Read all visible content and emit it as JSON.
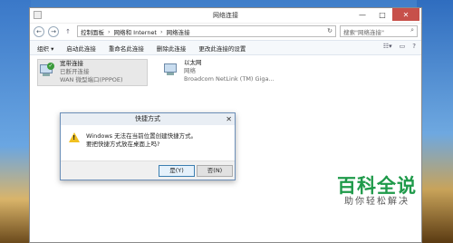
{
  "window": {
    "title": "网络连接",
    "controls": {
      "minimize": "—",
      "maximize": "□",
      "close": "✕"
    }
  },
  "address": {
    "segments": [
      "控制面板",
      "网络和 Internet",
      "网络连接"
    ],
    "separator": "›",
    "refresh": "↻",
    "search_placeholder": "搜索\"网络连接\""
  },
  "toolbar": {
    "items": [
      "组织 ▾",
      "启动此连接",
      "重命名此连接",
      "删除此连接",
      "更改此连接的设置"
    ]
  },
  "connections": [
    {
      "name": "宽带连接",
      "status": "已断开连接",
      "device": "WAN 微型端口(PPPOE)"
    },
    {
      "name": "以太网",
      "status": "网络",
      "device": "Broadcom NetLink (TM) Giga..."
    }
  ],
  "dialog": {
    "title": "快捷方式",
    "line1": "Windows 无法在当前位置创建快捷方式。",
    "line2": "要把快捷方式放在桌面上吗?",
    "yes_label": "是(Y)",
    "no_label": "否(N)",
    "close": "✕"
  },
  "watermark": {
    "big": "百科全说",
    "small": "助你轻松解决"
  }
}
